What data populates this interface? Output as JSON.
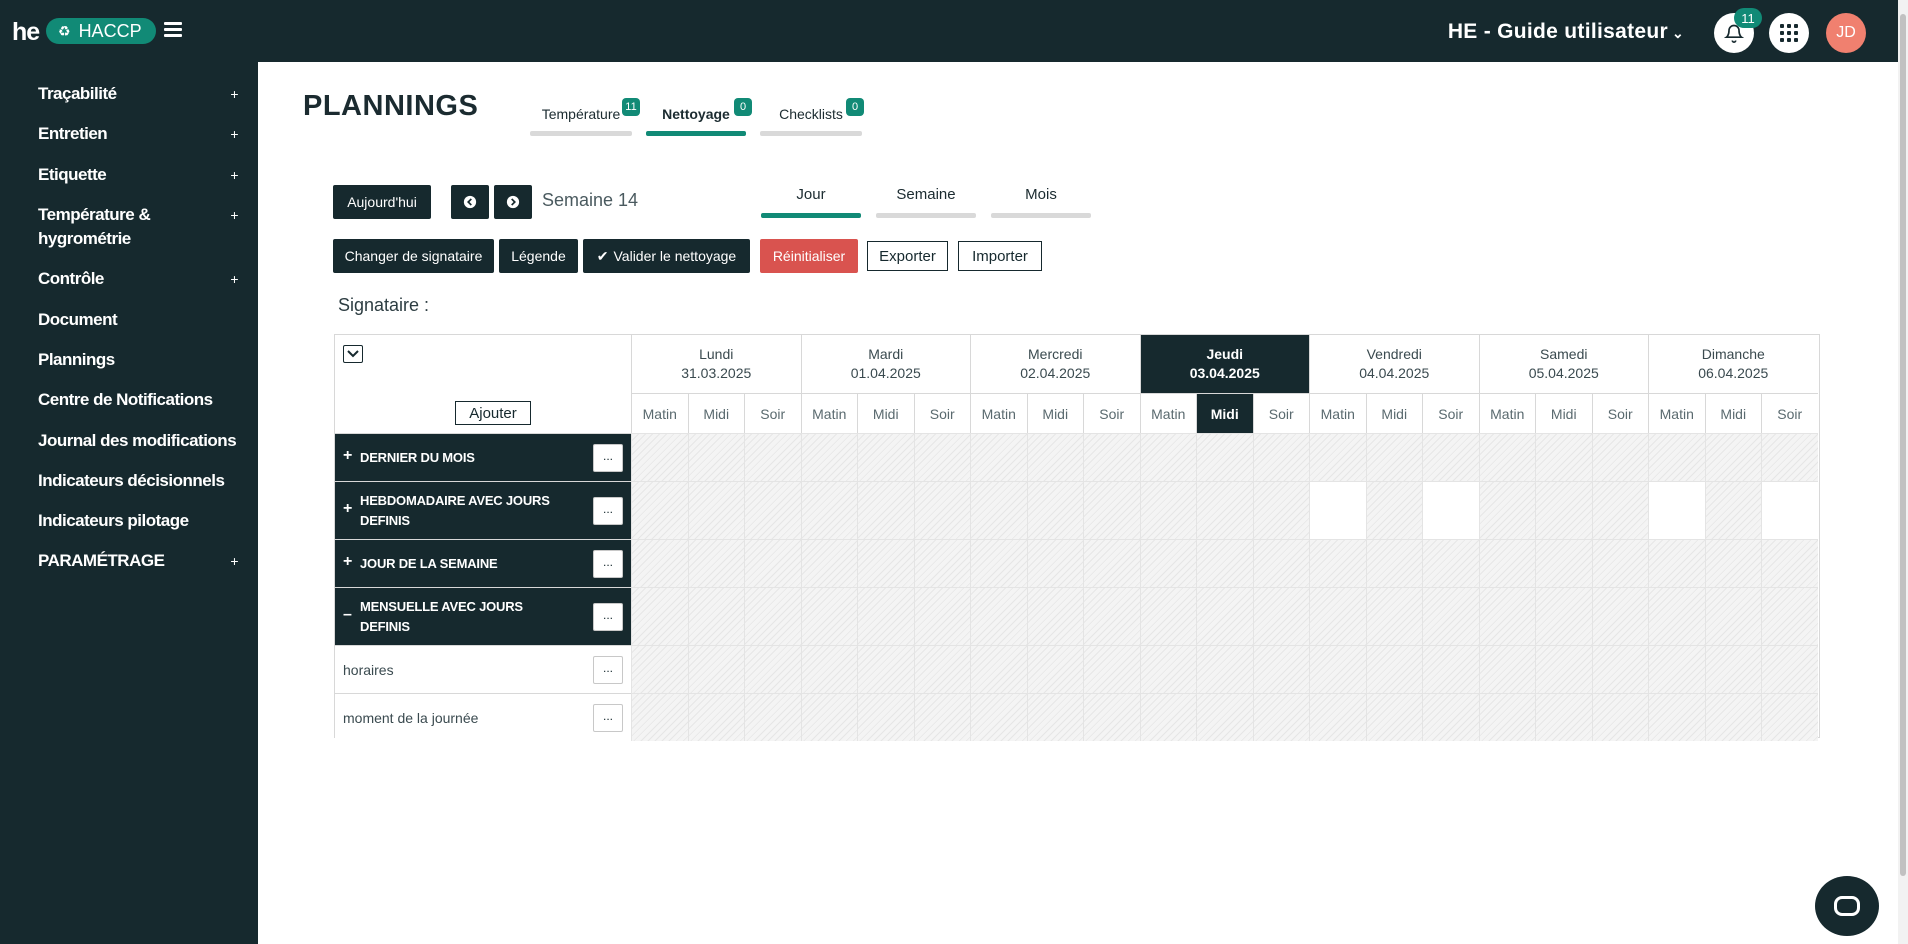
{
  "header": {
    "logo_text": "he",
    "app_name": "HACCP",
    "org_title": "HE - Guide utilisateur",
    "notification_count": "11",
    "avatar_initials": "JD"
  },
  "sidebar": {
    "items": [
      {
        "label": "Traçabilité",
        "plus": "+"
      },
      {
        "label": "Entretien",
        "plus": "+"
      },
      {
        "label": "Etiquette",
        "plus": "+"
      },
      {
        "label": "Température &",
        "label2": "hygrométrie",
        "plus": "+"
      },
      {
        "label": "Contrôle",
        "plus": "+"
      },
      {
        "label": "Document"
      },
      {
        "label": "Plannings"
      },
      {
        "label": "Centre de Notifications"
      },
      {
        "label": "Journal des modifications"
      },
      {
        "label": "Indicateurs décisionnels"
      },
      {
        "label": "Indicateurs pilotage"
      },
      {
        "label": "PARAMÉTRAGE",
        "plus": "+"
      }
    ]
  },
  "page": {
    "title": "PLANNINGS",
    "tabs": [
      {
        "label": "Température",
        "badge": "11"
      },
      {
        "label": "Nettoyage",
        "badge": "0"
      },
      {
        "label": "Checklists",
        "badge": "0"
      }
    ],
    "today_button": "Aujourd'hui",
    "week_label": "Semaine 14",
    "view_tabs": [
      "Jour",
      "Semaine",
      "Mois"
    ],
    "actions": {
      "change_signer": "Changer de signataire",
      "legend": "Légende",
      "validate": "Valider le nettoyage",
      "reset": "Réinitialiser",
      "export": "Exporter",
      "import": "Importer"
    },
    "signataire_label": "Signataire :"
  },
  "planning": {
    "add_button": "Ajouter",
    "days": [
      {
        "name": "Lundi",
        "date": "31.03.2025"
      },
      {
        "name": "Mardi",
        "date": "01.04.2025"
      },
      {
        "name": "Mercredi",
        "date": "02.04.2025"
      },
      {
        "name": "Jeudi",
        "date": "03.04.2025"
      },
      {
        "name": "Vendredi",
        "date": "04.04.2025"
      },
      {
        "name": "Samedi",
        "date": "05.04.2025"
      },
      {
        "name": "Dimanche",
        "date": "06.04.2025"
      }
    ],
    "slots": [
      "Matin",
      "Midi",
      "Soir"
    ],
    "rows": [
      {
        "sign": "+",
        "label": "DERNIER DU MOIS",
        "more": "..."
      },
      {
        "sign": "+",
        "label": "HEBDOMADAIRE AVEC JOURS",
        "label2": "DEFINIS",
        "more": "..."
      },
      {
        "sign": "+",
        "label": "JOUR DE LA SEMAINE",
        "more": "..."
      },
      {
        "sign": "–",
        "label": "MENSUELLE AVEC JOURS",
        "label2": "DEFINIS",
        "more": "..."
      },
      {
        "label": "horaires",
        "more": "..."
      },
      {
        "label": "moment de la journée",
        "more": "..."
      }
    ]
  },
  "colors": {
    "primary": "#16292e",
    "accent": "#118a76",
    "danger": "#d9534f",
    "avatar": "#f0806f"
  },
  "icons": [
    "bell-icon",
    "apps-icon",
    "hamburger-icon",
    "chevron-down-icon",
    "chevron-left-icon",
    "chevron-right-icon",
    "check-icon",
    "chat-icon",
    "leaf-icon"
  ]
}
